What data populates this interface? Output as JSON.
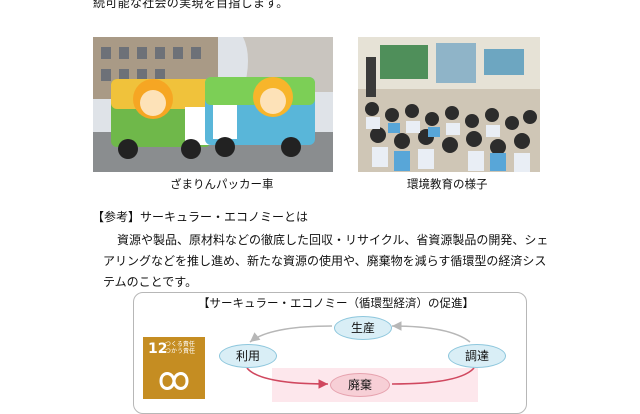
{
  "top_text": "続可能な社会の実現を目指します。",
  "photos": [
    {
      "caption": "ざまりんパッカー車"
    },
    {
      "caption": "環境教育の様子"
    }
  ],
  "reference": {
    "title": "【参考】サーキュラー・エコノミーとは",
    "body": "資源や製品、原材料などの徹底した回収・リサイクル、省資源製品の開発、シェアリングなどを推し進め、新たな資源の使用や、廃棄物を減らす循環型の経済システムのことです。"
  },
  "diagram": {
    "title": "【サーキュラー・エコノミー（循環型経済）の促進】",
    "nodes": {
      "production": "生産",
      "use": "利用",
      "procure": "調達",
      "waste": "廃棄"
    },
    "sdg_icon": {
      "number": "12",
      "line1": "つくる責任",
      "line2": "つかう責任",
      "color": "#c58d22"
    }
  }
}
